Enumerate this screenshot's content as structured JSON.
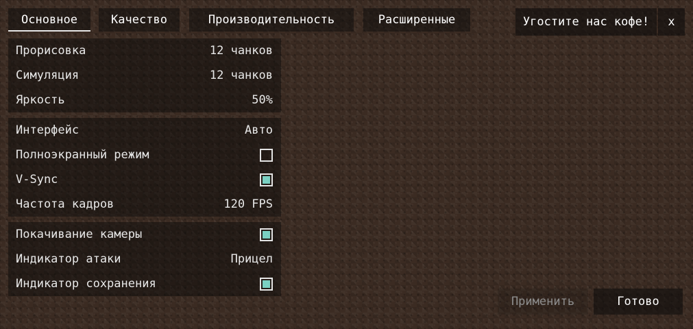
{
  "tabs": [
    {
      "label": "Основное",
      "active": true
    },
    {
      "label": "Качество",
      "active": false
    },
    {
      "label": "Производительность",
      "active": false
    },
    {
      "label": "Расширенные",
      "active": false
    }
  ],
  "header": {
    "coffee_label": "Угостите нас кофе!",
    "close_label": "x"
  },
  "groups": {
    "general": [
      {
        "label": "Прорисовка",
        "value": "12 чанков"
      },
      {
        "label": "Симуляция",
        "value": "12 чанков"
      },
      {
        "label": "Яркость",
        "value": "50%"
      }
    ],
    "display": [
      {
        "label": "Интерфейс",
        "value": "Авто"
      },
      {
        "label": "Полноэкранный режим",
        "checked": false
      },
      {
        "label": "V-Sync",
        "checked": true
      },
      {
        "label": "Частота кадров",
        "value": "120 FPS"
      }
    ],
    "misc": [
      {
        "label": "Покачивание камеры",
        "checked": true
      },
      {
        "label": "Индикатор атаки",
        "value": "Прицел"
      },
      {
        "label": "Индикатор сохранения",
        "checked": true
      }
    ]
  },
  "footer": {
    "apply_label": "Применить",
    "done_label": "Готово"
  },
  "colors": {
    "checkbox_fill": "#7ad0c2",
    "disabled_text": "#8e8e8e"
  }
}
